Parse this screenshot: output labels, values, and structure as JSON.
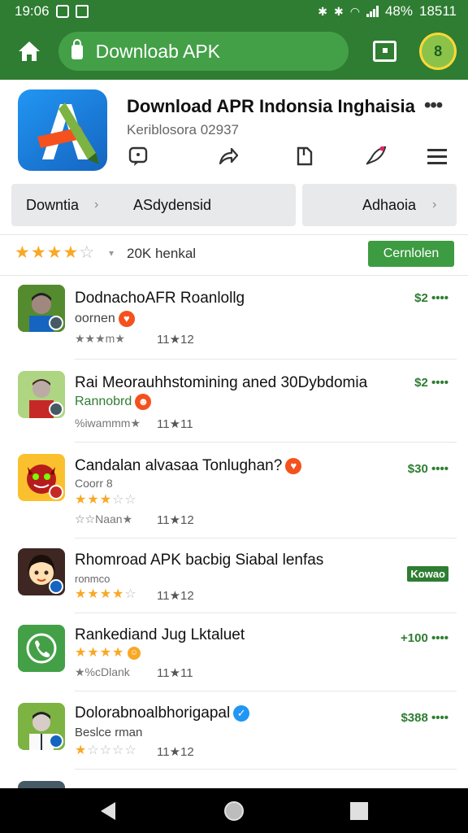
{
  "status_bar": {
    "time": "19:06",
    "battery": "48%",
    "clock_right": "18511"
  },
  "browser": {
    "url": "Downloab APK"
  },
  "app": {
    "title": "Download APR Indonsia Inghaisia",
    "subtitle": "Keriblosora  02937"
  },
  "chips": [
    {
      "label_left": "Downtia",
      "label_right": "ASdydensid"
    },
    {
      "label": "Adhaoia"
    }
  ],
  "rating": {
    "value": 4,
    "out_of": 5,
    "label": "20K henkal",
    "download_label": "Cernlolen"
  },
  "items": [
    {
      "title": "DodnachoAFR Roanlollg",
      "subtitle": "oornen",
      "meta": "★★★m★",
      "count": "11★12",
      "price": "$2 ••••",
      "icon": "boy-avatar"
    },
    {
      "title": "Rai Meorauhhstomining aned 30Dybdomia",
      "subtitle": "Rannobrd",
      "meta": "%iwammm★",
      "count": "11★11",
      "price": "$2 ••••",
      "icon": "boy-red-avatar"
    },
    {
      "title": "Candalan alvasaa Tonlughan?",
      "subtitle": "Coorr 8",
      "meta": "☆☆Naan★",
      "count": "11★12",
      "price": "$30 ••••",
      "icon": "devil-avatar"
    },
    {
      "title": "Rhomroad APK bacbig Siabal lenfas",
      "subtitle": "ronmco",
      "meta": "",
      "count": "11★12",
      "price": "Kowao",
      "icon": "girl-avatar"
    },
    {
      "title": "Rankediand Jug Lktaluet",
      "subtitle": "",
      "meta": "★%cDlank",
      "count": "11★11",
      "price": "+100 ••••",
      "icon": "phone-icon"
    },
    {
      "title": "Dolorabnoalbhorigapal",
      "subtitle": "Beslce rman",
      "meta": "",
      "count": "11★12",
      "price": "$388 ••••",
      "icon": "boy-shirt-avatar"
    }
  ],
  "colors": {
    "brand": "#2e7d32",
    "accent": "#43a047",
    "star": "#f9a825"
  }
}
